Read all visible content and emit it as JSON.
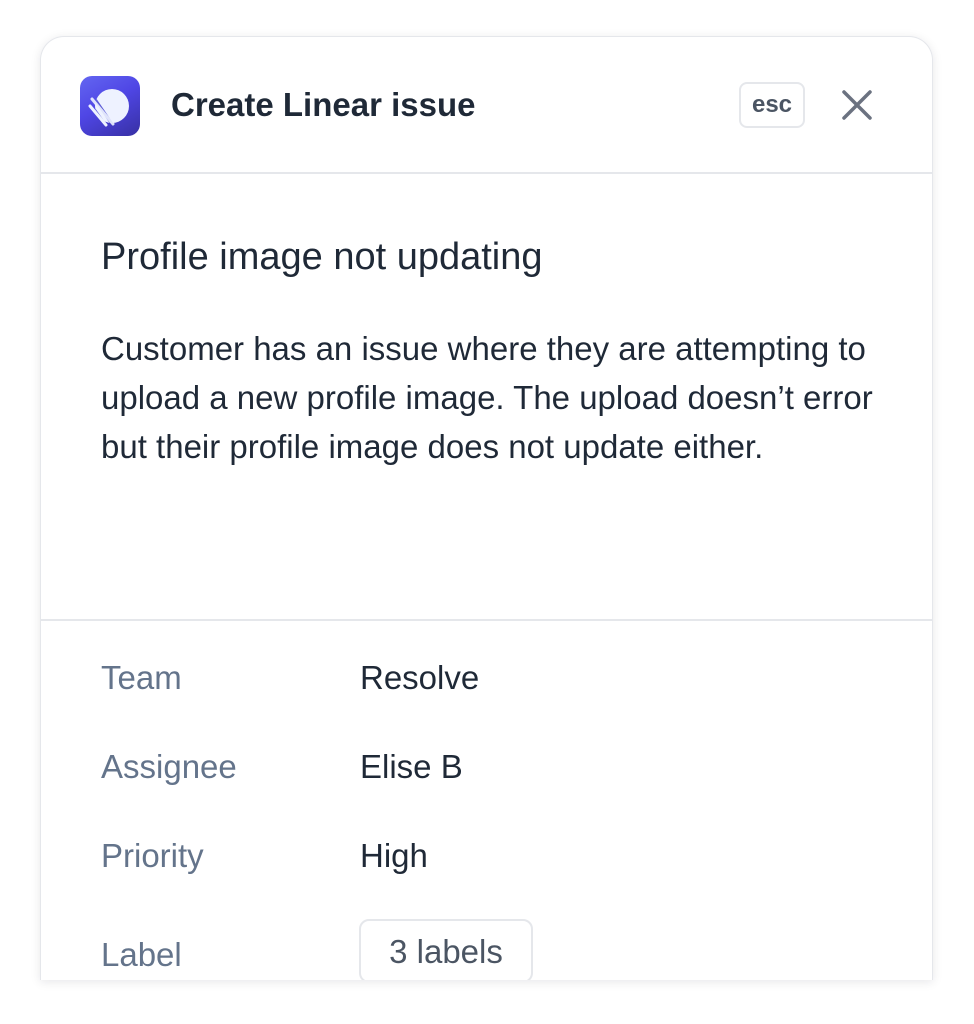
{
  "header": {
    "title": "Create Linear issue",
    "esc_label": "esc",
    "app_icon": "linear-logo-icon",
    "close_icon": "close-icon"
  },
  "issue": {
    "title": "Profile image not updating",
    "description": "Customer has an issue where they are attempting to upload a new profile image. The upload doesn’t error but their profile image does not update either."
  },
  "fields": {
    "team": {
      "label": "Team",
      "value": "Resolve"
    },
    "assignee": {
      "label": "Assignee",
      "value": "Elise B"
    },
    "priority": {
      "label": "Priority",
      "value": "High"
    },
    "label": {
      "label": "Label",
      "value": "3 labels"
    }
  },
  "colors": {
    "brand_gradient_start": "#6366f1",
    "brand_gradient_end": "#3730a3",
    "text_primary": "#1f2937",
    "text_muted": "#64748b",
    "border": "#e5e7eb"
  }
}
